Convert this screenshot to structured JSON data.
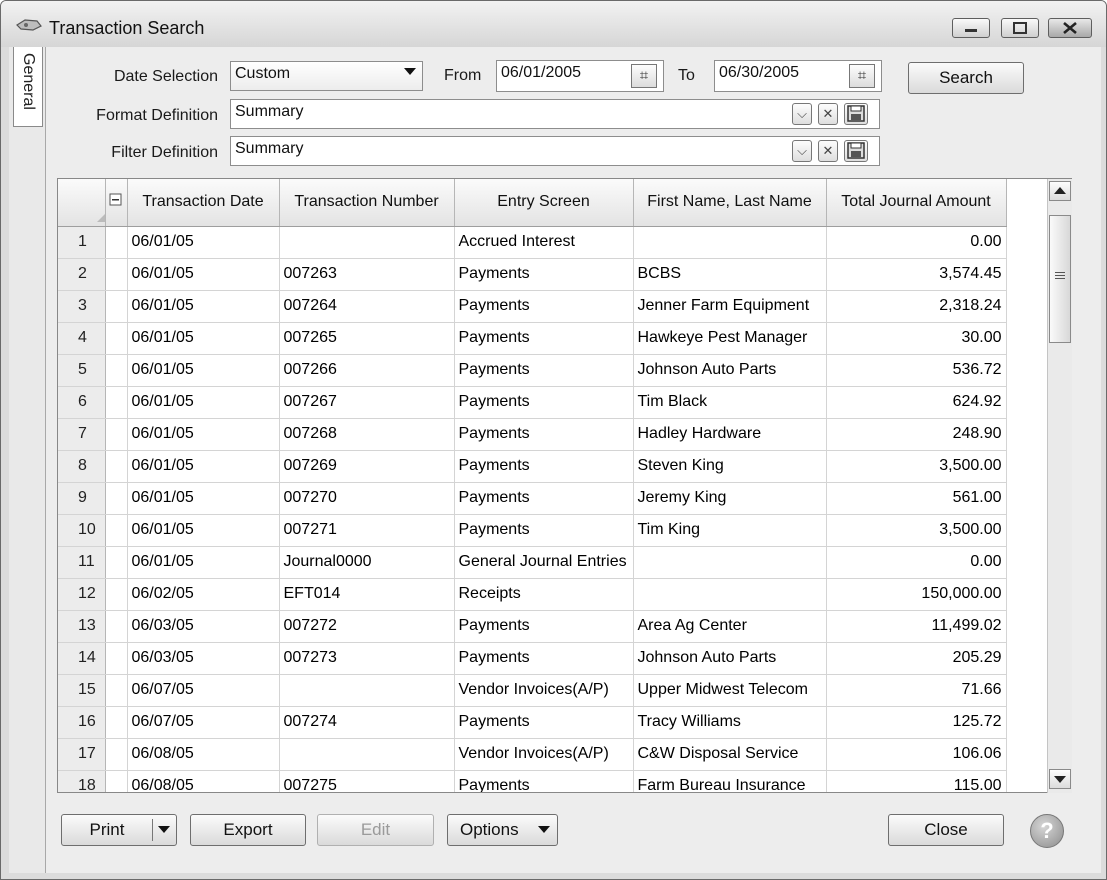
{
  "window": {
    "title": "Transaction Search"
  },
  "sidetab": {
    "label": "General"
  },
  "date_selection": {
    "label": "Date Selection",
    "value": "Custom"
  },
  "from": {
    "label": "From",
    "value": "06/01/2005"
  },
  "to": {
    "label": "To",
    "value": "06/30/2005"
  },
  "search_button": "Search",
  "format_definition": {
    "label": "Format Definition",
    "value": "Summary"
  },
  "filter_definition": {
    "label": "Filter Definition",
    "value": "Summary"
  },
  "grid": {
    "columns": [
      "Transaction Date",
      "Transaction Number",
      "Entry Screen",
      "First Name, Last Name",
      "Total Journal Amount"
    ],
    "rows": [
      {
        "n": "1",
        "date": "06/01/05",
        "num": "",
        "screen": "Accrued Interest",
        "name": "",
        "amount": "0.00"
      },
      {
        "n": "2",
        "date": "06/01/05",
        "num": "007263",
        "screen": "Payments",
        "name": "BCBS",
        "amount": "3,574.45"
      },
      {
        "n": "3",
        "date": "06/01/05",
        "num": "007264",
        "screen": "Payments",
        "name": "Jenner Farm Equipment",
        "amount": "2,318.24"
      },
      {
        "n": "4",
        "date": "06/01/05",
        "num": "007265",
        "screen": "Payments",
        "name": "Hawkeye Pest Manager",
        "amount": "30.00"
      },
      {
        "n": "5",
        "date": "06/01/05",
        "num": "007266",
        "screen": "Payments",
        "name": "Johnson Auto Parts",
        "amount": "536.72"
      },
      {
        "n": "6",
        "date": "06/01/05",
        "num": "007267",
        "screen": "Payments",
        "name": "Tim Black",
        "amount": "624.92"
      },
      {
        "n": "7",
        "date": "06/01/05",
        "num": "007268",
        "screen": "Payments",
        "name": "Hadley Hardware",
        "amount": "248.90"
      },
      {
        "n": "8",
        "date": "06/01/05",
        "num": "007269",
        "screen": "Payments",
        "name": "Steven King",
        "amount": "3,500.00"
      },
      {
        "n": "9",
        "date": "06/01/05",
        "num": "007270",
        "screen": "Payments",
        "name": "Jeremy King",
        "amount": "561.00"
      },
      {
        "n": "10",
        "date": "06/01/05",
        "num": "007271",
        "screen": "Payments",
        "name": "Tim King",
        "amount": "3,500.00"
      },
      {
        "n": "11",
        "date": "06/01/05",
        "num": "Journal0000",
        "screen": "General Journal Entries",
        "name": "",
        "amount": "0.00"
      },
      {
        "n": "12",
        "date": "06/02/05",
        "num": "EFT014",
        "screen": "Receipts",
        "name": "",
        "amount": "150,000.00"
      },
      {
        "n": "13",
        "date": "06/03/05",
        "num": "007272",
        "screen": "Payments",
        "name": "Area Ag Center",
        "amount": "11,499.02"
      },
      {
        "n": "14",
        "date": "06/03/05",
        "num": "007273",
        "screen": "Payments",
        "name": "Johnson Auto Parts",
        "amount": "205.29"
      },
      {
        "n": "15",
        "date": "06/07/05",
        "num": "",
        "screen": "Vendor Invoices(A/P)",
        "name": "Upper Midwest Telecom",
        "amount": "71.66"
      },
      {
        "n": "16",
        "date": "06/07/05",
        "num": "007274",
        "screen": "Payments",
        "name": "Tracy Williams",
        "amount": "125.72"
      },
      {
        "n": "17",
        "date": "06/08/05",
        "num": "",
        "screen": "Vendor Invoices(A/P)",
        "name": "C&W Disposal Service",
        "amount": "106.06"
      },
      {
        "n": "18",
        "date": "06/08/05",
        "num": "007275",
        "screen": "Payments",
        "name": "Farm Bureau Insurance",
        "amount": "115.00"
      }
    ]
  },
  "buttons": {
    "print": "Print",
    "export": "Export",
    "edit": "Edit",
    "options": "Options",
    "close": "Close",
    "help": "?"
  },
  "icons": {
    "title": "app-icon",
    "calendar": "calendar-icon",
    "clear": "clear-icon",
    "save": "save-icon",
    "help": "help-icon"
  }
}
